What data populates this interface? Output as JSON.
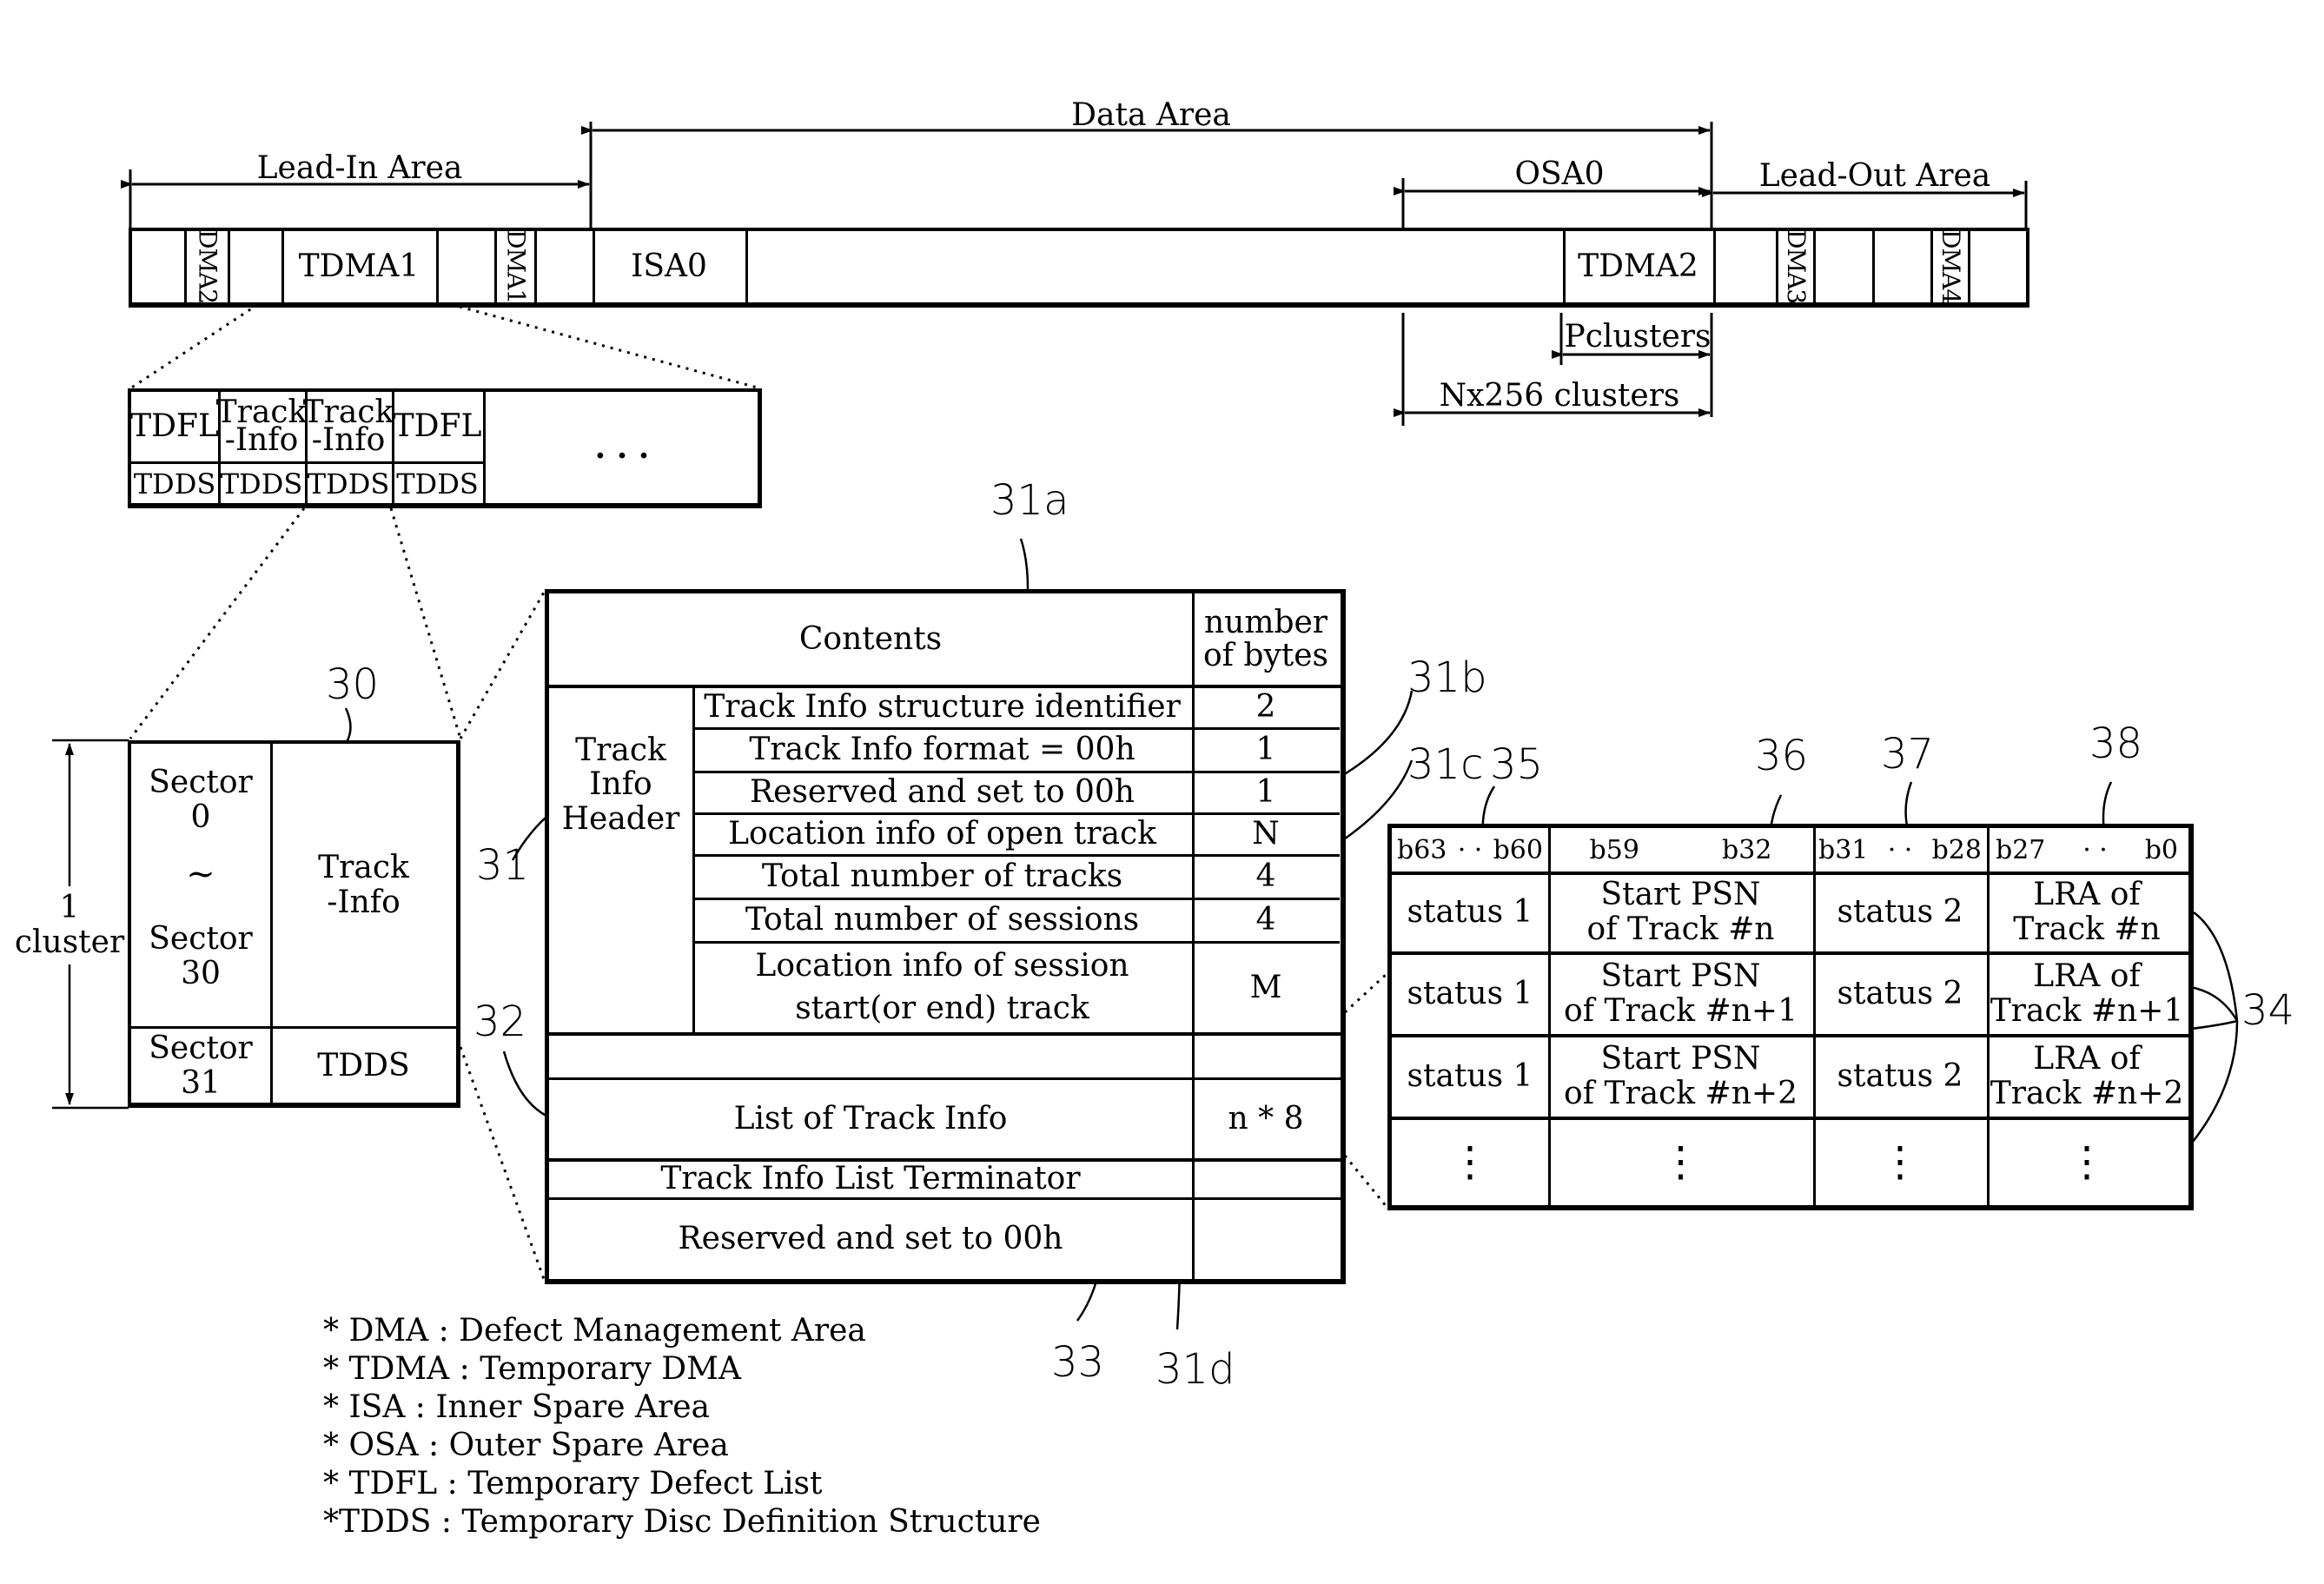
{
  "layout_bar": {
    "lead_in_label": "Lead-In Area",
    "data_area_label": "Data Area",
    "osa_label": "OSA0",
    "lead_out_label": "Lead-Out Area",
    "segments": {
      "dma2": "DMA2",
      "tdma1": "TDMA1",
      "dma1": "DMA1",
      "isa0": "ISA0",
      "tdma2": "TDMA2",
      "dma3": "DMA3",
      "dma4": "DMA4"
    },
    "p_clusters": "Pclusters",
    "n_clusters": "Nx256 clusters"
  },
  "tdma_detail": {
    "top_row": [
      "TDFL",
      "Track\n-Info",
      "Track\n-Info",
      "TDFL"
    ],
    "bottom_row": [
      "TDDS",
      "TDDS",
      "TDDS",
      "TDDS"
    ],
    "ellipsis": ". . ."
  },
  "cluster": {
    "size_label": "1\ncluster",
    "ref": "30",
    "sector0": "Sector\n0",
    "tilde": "~",
    "sector30": "Sector\n30",
    "sector31": "Sector\n31",
    "track_info": "Track\n-Info",
    "tdds": "TDDS"
  },
  "track_info_table": {
    "header_contents": "Contents",
    "header_bytes": "number\nof bytes",
    "group_label": "Track\nInfo\nHeader",
    "rows": [
      {
        "content": "Track Info structure identifier",
        "bytes": "2"
      },
      {
        "content": "Track Info format = 00h",
        "bytes": "1"
      },
      {
        "content": "Reserved and set to 00h",
        "bytes": "1"
      },
      {
        "content": "Location info of open track",
        "bytes": "N"
      },
      {
        "content": "Total number of tracks",
        "bytes": "4"
      },
      {
        "content": "Total number of sessions",
        "bytes": "4"
      },
      {
        "content": "Location info of session\nstart(or end) track",
        "bytes": "M"
      }
    ],
    "list_label": "List of Track Info",
    "list_bytes": "n * 8",
    "terminator": "Track Info List Terminator",
    "reserved": "Reserved and set to 00h"
  },
  "track_list_table": {
    "headers": [
      {
        "left": "b63",
        "sep": "· ·",
        "right": "b60"
      },
      {
        "left": "b59",
        "sep": "",
        "right": "b32"
      },
      {
        "left": "b31",
        "sep": "· ·",
        "right": "b28"
      },
      {
        "left": "b27",
        "sep": "· ·",
        "right": "b0"
      }
    ],
    "rows": [
      [
        "status 1",
        "Start PSN\nof Track #n",
        "status 2",
        "LRA of\nTrack #n"
      ],
      [
        "status 1",
        "Start PSN\nof Track #n+1",
        "status 2",
        "LRA of\nTrack #n+1"
      ],
      [
        "status 1",
        "Start PSN\nof Track #n+2",
        "status 2",
        "LRA of\nTrack #n+2"
      ],
      [
        "⋮",
        "⋮",
        "⋮",
        "⋮"
      ]
    ]
  },
  "reference_numerals": {
    "r30": "30",
    "r31": "31",
    "r31a": "31a",
    "r31b": "31b",
    "r31c": "31c",
    "r31d": "31d",
    "r32": "32",
    "r33": "33",
    "r34": "34",
    "r35": "35",
    "r36": "36",
    "r37": "37",
    "r38": "38"
  },
  "legend": [
    "* DMA :  Defect Management Area",
    "* TDMA : Temporary DMA",
    "* ISA : Inner Spare Area",
    "* OSA :  Outer Spare Area",
    "* TDFL :  Temporary Defect List",
    "*TDDS :  Temporary Disc Definition Structure"
  ]
}
